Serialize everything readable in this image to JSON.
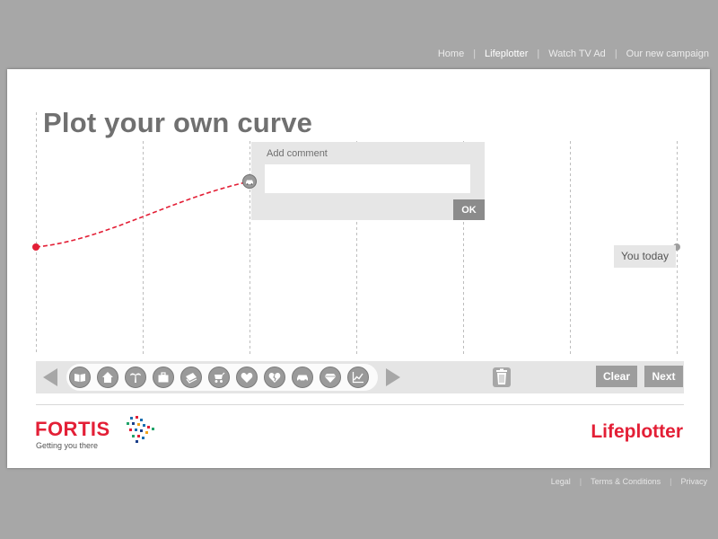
{
  "top_nav": {
    "items": [
      {
        "label": "Home",
        "active": false
      },
      {
        "label": "Lifeplotter",
        "active": true
      },
      {
        "label": "Watch TV Ad",
        "active": false
      },
      {
        "label": "Our new campaign",
        "active": false
      }
    ],
    "separator": "|"
  },
  "main": {
    "title": "Plot your own curve"
  },
  "comment_popup": {
    "label": "Add comment",
    "input_value": "",
    "input_placeholder": "",
    "ok_label": "OK"
  },
  "today": {
    "label": "You today"
  },
  "toolbar": {
    "icons": [
      "book-icon",
      "house-icon",
      "palm-tree-icon",
      "briefcase-icon",
      "money-icon",
      "pram-icon",
      "heart-icon",
      "broken-heart-icon",
      "car-icon",
      "diamond-icon",
      "line-chart-icon"
    ],
    "trash_icon": "trash-icon",
    "clear_label": "Clear",
    "next_label": "Next"
  },
  "footer": {
    "brand_name": "FORTIS",
    "brand_tagline": "Getting you there",
    "product_name": "Lifeplotter",
    "links": [
      "Legal",
      "Terms & Conditions",
      "Privacy"
    ],
    "separator": "|"
  },
  "colors": {
    "accent": "#e31f36",
    "page_background": "#a7a7a7",
    "panel_background": "#ffffff",
    "title_text": "#707070",
    "popup_background": "#e6e6e6",
    "button_gray": "#9d9d9d",
    "gridline": "#bdbdbd"
  }
}
